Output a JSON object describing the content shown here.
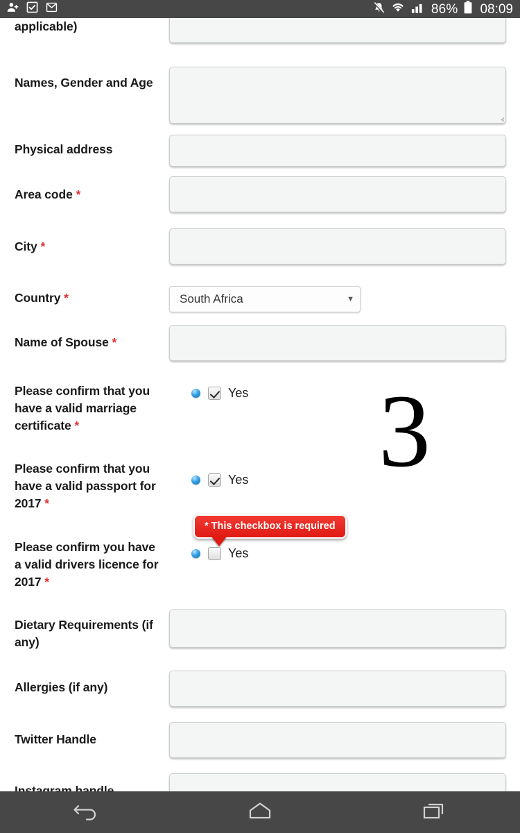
{
  "statusbar": {
    "icons_left": [
      "person-add-icon",
      "tasks-checkbox-icon",
      "gmail-icon"
    ],
    "icons_right": [
      "notifications-muted-icon",
      "wifi-icon",
      "cellular-signal-icon"
    ],
    "battery": "86%",
    "time": "08:09"
  },
  "form": {
    "fields": [
      {
        "label_prefix": "applicable)",
        "required": false,
        "control": "textarea",
        "value": "",
        "name": "applicable-field"
      },
      {
        "label_prefix": "Names, Gender and Age",
        "required": false,
        "control": "textarea",
        "value": "",
        "name": "names-gender-age"
      },
      {
        "label_prefix": "Physical address",
        "required": false,
        "control": "text",
        "value": "",
        "name": "physical-address"
      },
      {
        "label_prefix": "Area code",
        "required": true,
        "control": "text",
        "value": "",
        "name": "area-code"
      },
      {
        "label_prefix": "City",
        "required": true,
        "control": "text",
        "value": "",
        "name": "city"
      },
      {
        "label_prefix": "Country",
        "required": true,
        "control": "select",
        "value": "South Africa",
        "name": "country"
      },
      {
        "label_prefix": "Name of Spouse",
        "required": true,
        "control": "text",
        "value": "",
        "name": "name-of-spouse"
      },
      {
        "label_prefix": "Please confirm that you have a valid marriage certificate",
        "required": true,
        "control": "checkbox",
        "checked": true,
        "option": "Yes",
        "name": "confirm-marriage-certificate"
      },
      {
        "label_prefix": "Please confirm that you have a valid passport for 2017",
        "required": true,
        "control": "checkbox",
        "checked": true,
        "option": "Yes",
        "name": "confirm-passport-2017"
      },
      {
        "label_prefix": "Please confirm you have a valid drivers licence for 2017",
        "required": true,
        "control": "checkbox",
        "checked": false,
        "option": "Yes",
        "name": "confirm-drivers-licence-2017"
      },
      {
        "label_prefix": "Dietary Requirements (if any)",
        "required": false,
        "control": "text",
        "value": "",
        "name": "dietary-requirements"
      },
      {
        "label_prefix": "Allergies (if any)",
        "required": false,
        "control": "text",
        "value": "",
        "name": "allergies"
      },
      {
        "label_prefix": "Twitter Handle",
        "required": false,
        "control": "text",
        "value": "",
        "name": "twitter-handle"
      },
      {
        "label_prefix": "Instagram handle",
        "required": false,
        "control": "text",
        "value": "",
        "name": "instagram-handle"
      }
    ],
    "required_marker": "*",
    "select_arrow": "▼",
    "validation_tooltip": "* This checkbox is required"
  },
  "overlay": {
    "step_number": "3"
  },
  "navbar": {
    "items": [
      "back-icon",
      "home-icon",
      "recents-icon"
    ]
  },
  "colors": {
    "statusbar_bg": "#474747",
    "navbar_bg": "#474747",
    "field_bg": "#f4f6f6",
    "field_border": "#c9cccc",
    "required_red": "#e03030",
    "tooltip_red": "#e01b14",
    "bullet_blue": "#37a4e8",
    "label_text": "#1a1a1a"
  }
}
